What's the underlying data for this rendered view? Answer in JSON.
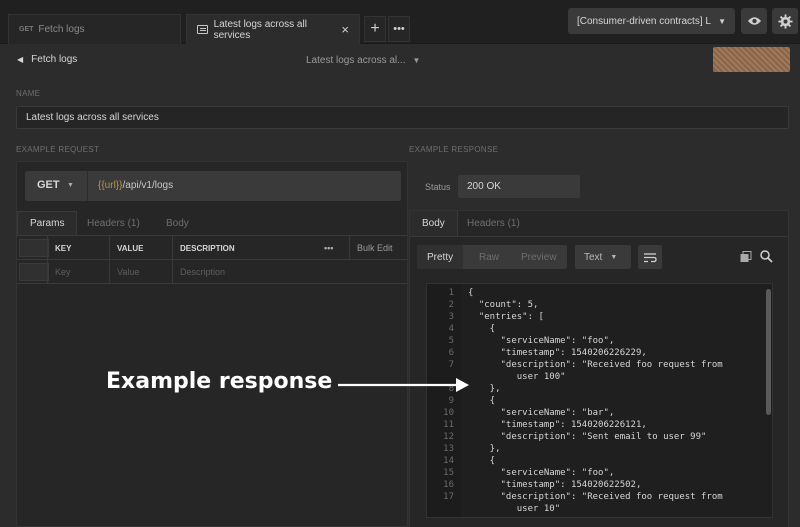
{
  "tabs": [
    {
      "method": "GET",
      "label": "Fetch logs",
      "active": false
    },
    {
      "label": "Latest logs across all services",
      "active": true
    }
  ],
  "environment": {
    "label": "[Consumer-driven contracts] L"
  },
  "header": {
    "back_label": "Fetch logs",
    "center_title": "Latest logs across al..."
  },
  "name": {
    "label": "NAME",
    "value": "Latest logs across all services"
  },
  "request": {
    "section_label": "EXAMPLE REQUEST",
    "method": "GET",
    "url_var": "{{url}}",
    "url_path": "/api/v1/logs",
    "tabs": [
      "Params",
      "Headers (1)",
      "Body"
    ],
    "active_tab": "Params",
    "table": {
      "headers": [
        "KEY",
        "VALUE",
        "DESCRIPTION"
      ],
      "more": "•••",
      "bulk_edit": "Bulk Edit",
      "placeholders": [
        "Key",
        "Value",
        "Description"
      ]
    }
  },
  "response": {
    "section_label": "EXAMPLE RESPONSE",
    "status_label": "Status",
    "status_value": "200 OK",
    "tabs": [
      "Body",
      "Headers (1)"
    ],
    "active_tab": "Body",
    "views": [
      "Pretty",
      "Raw",
      "Preview"
    ],
    "active_view": "Pretty",
    "format": "Text",
    "code_lines": [
      {
        "n": "1",
        "text": "{"
      },
      {
        "n": "2",
        "text": "  \"count\": 5,"
      },
      {
        "n": "3",
        "text": "  \"entries\": ["
      },
      {
        "n": "4",
        "text": "    {"
      },
      {
        "n": "5",
        "text": "      \"serviceName\": \"foo\","
      },
      {
        "n": "6",
        "text": "      \"timestamp\": 1540206226229,"
      },
      {
        "n": "7",
        "text": "      \"description\": \"Received foo request from"
      },
      {
        "n": "",
        "text": "         user 100\""
      },
      {
        "n": "8",
        "text": "    },"
      },
      {
        "n": "9",
        "text": "    {"
      },
      {
        "n": "10",
        "text": "      \"serviceName\": \"bar\","
      },
      {
        "n": "11",
        "text": "      \"timestamp\": 1540206226121,"
      },
      {
        "n": "12",
        "text": "      \"description\": \"Sent email to user 99\""
      },
      {
        "n": "13",
        "text": "    },"
      },
      {
        "n": "14",
        "text": "    {"
      },
      {
        "n": "15",
        "text": "      \"serviceName\": \"foo\","
      },
      {
        "n": "16",
        "text": "      \"timestamp\": 154020622502,"
      },
      {
        "n": "17",
        "text": "      \"description\": \"Received foo request from"
      },
      {
        "n": "",
        "text": "         user 10\""
      }
    ]
  },
  "annotation": {
    "text": "Example response"
  }
}
